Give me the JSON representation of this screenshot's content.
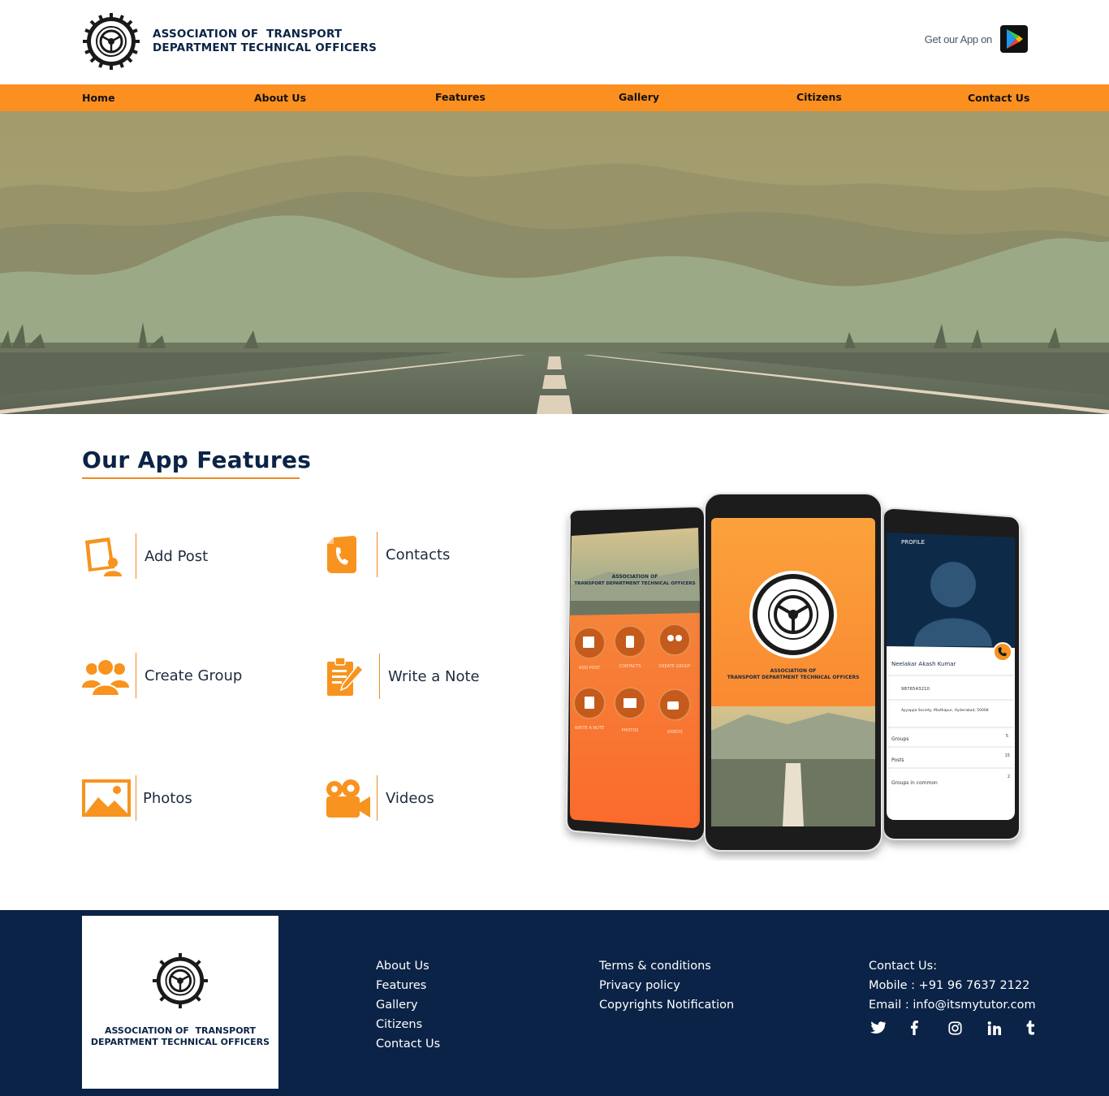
{
  "brand": {
    "line1": "ASSOCIATION OF  TRANSPORT",
    "line2": "DEPARTMENT TECHNICAL OFFICERS"
  },
  "header": {
    "get_app_label": "Get our App on",
    "store_icon": "google-play-icon"
  },
  "nav": {
    "items": [
      {
        "label": "Home"
      },
      {
        "label": "About Us"
      },
      {
        "label": "Features"
      },
      {
        "label": "Gallery"
      },
      {
        "label": "Citizens"
      },
      {
        "label": "Contact Us"
      }
    ]
  },
  "features": {
    "title": "Our App Features",
    "items": [
      {
        "label": "Add Post",
        "icon": "add-post-icon"
      },
      {
        "label": "Contacts",
        "icon": "contacts-icon"
      },
      {
        "label": "Create Group",
        "icon": "create-group-icon"
      },
      {
        "label": "Write a Note",
        "icon": "write-note-icon"
      },
      {
        "label": "Photos",
        "icon": "photos-icon"
      },
      {
        "label": "Videos",
        "icon": "videos-icon"
      }
    ]
  },
  "phones": {
    "left": {
      "org_line1": "ASSOCIATION OF",
      "org_line2": "TRANSPORT DEPARTMENT TECHNICAL OFFICERS",
      "tiles": [
        "ADD POST",
        "CONTACTS",
        "CREATE GROUP",
        "WRITE A NOTE",
        "PHOTOS",
        "VIDEOS"
      ]
    },
    "center": {
      "org_line1": "ASSOCIATION OF",
      "org_line2": "TRANSPORT DEPARTMENT TECHNICAL OFFICERS"
    },
    "right": {
      "header": "PROFILE",
      "name": "Neelakar Akash Kumar",
      "phone": "9876543210",
      "address": "Ayyappa Society, Madhapur, Hyderabad, 50008",
      "rows": [
        {
          "label": "Groups",
          "value": "5"
        },
        {
          "label": "Posts",
          "value": "15"
        },
        {
          "label": "Groups in common",
          "value": "2"
        }
      ]
    }
  },
  "footer": {
    "brand_line1": "ASSOCIATION OF  TRANSPORT",
    "brand_line2": "DEPARTMENT TECHNICAL OFFICERS",
    "links": [
      "About Us",
      "Features",
      "Gallery",
      "Citizens",
      "Contact Us"
    ],
    "legal": [
      "Terms & conditions",
      "Privacy policy",
      "Copyrights Notification"
    ],
    "contact": {
      "heading": "Contact Us:",
      "mobile": "Mobile : +91 96 7637 2122",
      "email": "Email : info@itsmytutor.com"
    },
    "socials": [
      "twitter-icon",
      "facebook-icon",
      "instagram-icon",
      "linkedin-icon",
      "tumblr-icon"
    ]
  },
  "colors": {
    "navy": "#0b2346",
    "orange": "#fb8f1f",
    "accent_orange": "#f08a24"
  }
}
